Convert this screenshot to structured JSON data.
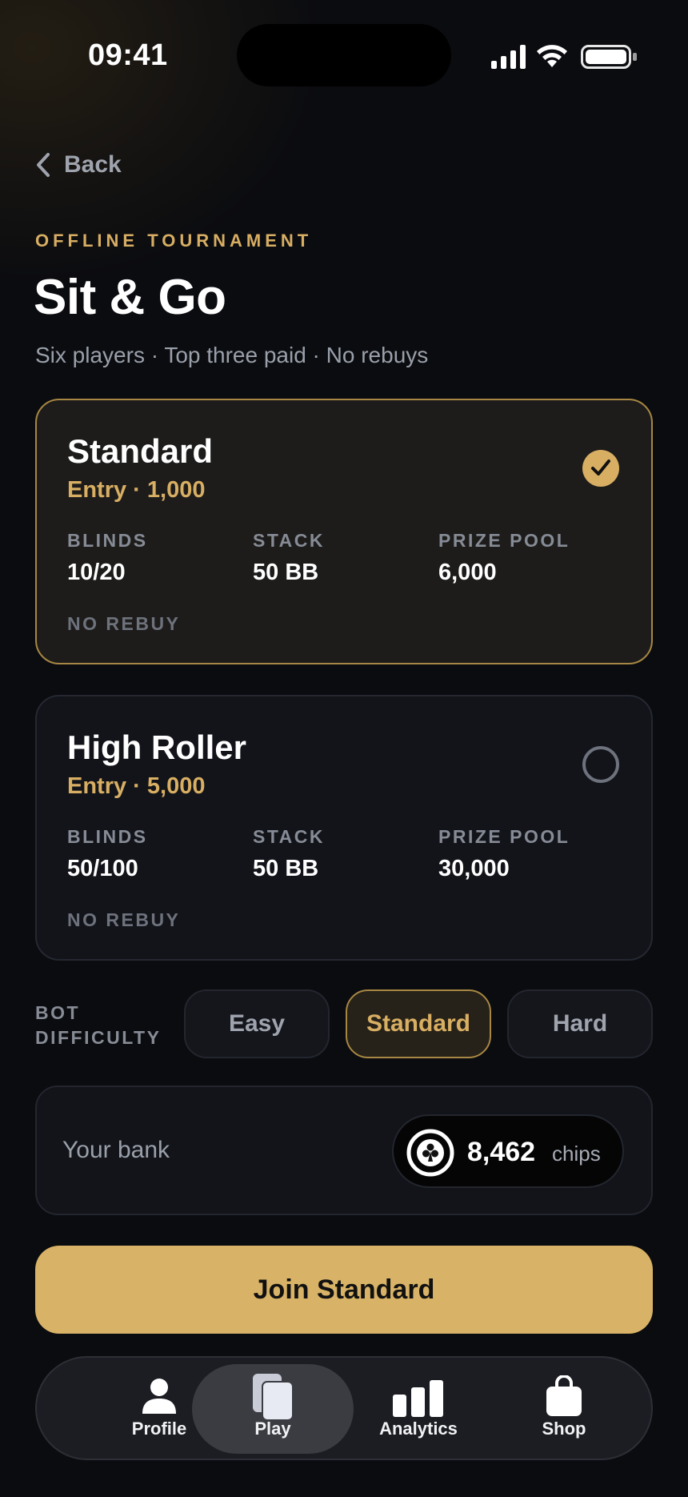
{
  "status": {
    "time": "09:41"
  },
  "nav": {
    "back_label": "Back"
  },
  "header": {
    "eyebrow": "OFFLINE TOURNAMENT",
    "title": "Sit & Go",
    "subtitle": "Six players · Top three paid · No rebuys"
  },
  "tables": [
    {
      "name": "Standard",
      "entry": "Entry · 1,000",
      "selected": true,
      "stats": [
        {
          "label": "BLINDS",
          "value": "10/20"
        },
        {
          "label": "STACK",
          "value": "50 BB"
        },
        {
          "label": "PRIZE POOL",
          "value": "6,000"
        }
      ],
      "rebuy": "NO REBUY"
    },
    {
      "name": "High Roller",
      "entry": "Entry · 5,000",
      "selected": false,
      "stats": [
        {
          "label": "BLINDS",
          "value": "50/100"
        },
        {
          "label": "STACK",
          "value": "50 BB"
        },
        {
          "label": "PRIZE POOL",
          "value": "30,000"
        }
      ],
      "rebuy": "NO REBUY"
    }
  ],
  "difficulty": {
    "label": "BOT DIFFICULTY",
    "options": [
      "Easy",
      "Standard",
      "Hard"
    ],
    "selected": "Standard"
  },
  "bank": {
    "label": "Your bank",
    "amount": "8,462",
    "unit": "chips",
    "icon": "club-chip-icon"
  },
  "join_label": "Join Standard",
  "tabbar": {
    "items": [
      {
        "label": "Profile",
        "icon": "person-icon"
      },
      {
        "label": "Play",
        "icon": "cards-icon"
      },
      {
        "label": "Analytics",
        "icon": "bar-chart-icon"
      },
      {
        "label": "Shop",
        "icon": "bag-icon"
      }
    ],
    "active": "Play"
  },
  "colors": {
    "accent": "#d8ae63",
    "background": "#0b0c10",
    "card": "#12141a",
    "selected_border": "#a78743"
  }
}
